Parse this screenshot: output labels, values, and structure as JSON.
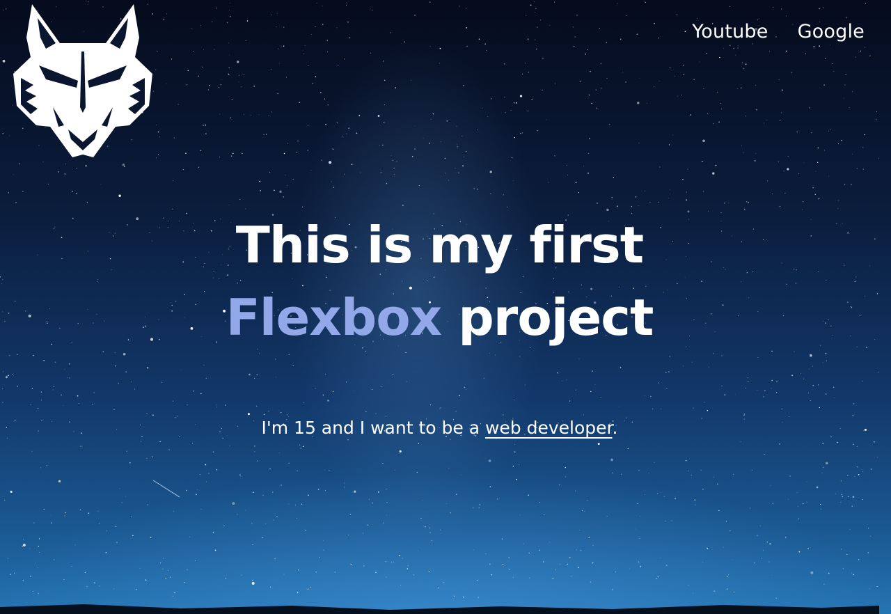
{
  "header": {
    "logo": {
      "icon": "wolf-head-logo-icon"
    },
    "nav": {
      "items": [
        {
          "label": "Youtube"
        },
        {
          "label": "Google"
        }
      ]
    }
  },
  "hero": {
    "title_start": "This is my first ",
    "title_accent": "Flexbox",
    "title_end": " project",
    "subtitle_start": "I'm 15 and I want to be a ",
    "subtitle_link": "web developer",
    "subtitle_end": "."
  },
  "colors": {
    "accent": "#93a8e8",
    "text": "#ffffff",
    "sky_top": "#050b1c",
    "sky_bottom": "#2474b2"
  }
}
